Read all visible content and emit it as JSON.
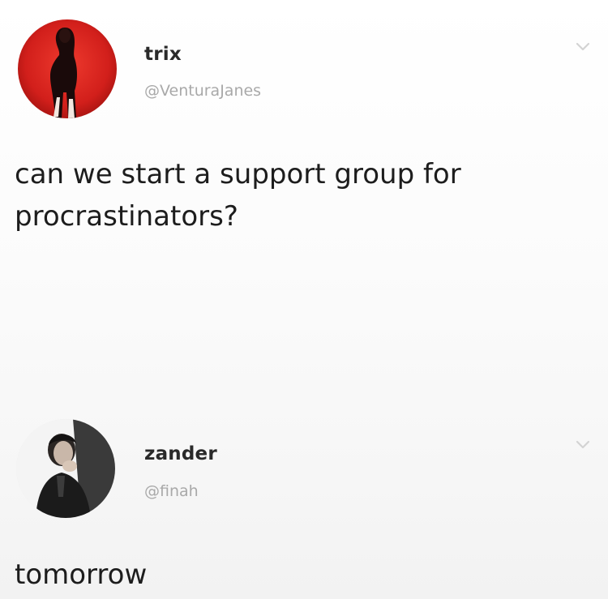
{
  "tweets": [
    {
      "display_name": "trix",
      "handle": "@VenturaJanes",
      "text": "can we start a support group for\nprocrastinators?",
      "avatar_icon": "profile-photo-red-background",
      "avatar_bg": "#d21f1b"
    },
    {
      "display_name": "zander",
      "handle": "@finah",
      "text": "tomorrow",
      "avatar_icon": "profile-photo-man-portrait",
      "avatar_bg": "#e9e9e9"
    }
  ],
  "menu_icon": "chevron-down-icon"
}
